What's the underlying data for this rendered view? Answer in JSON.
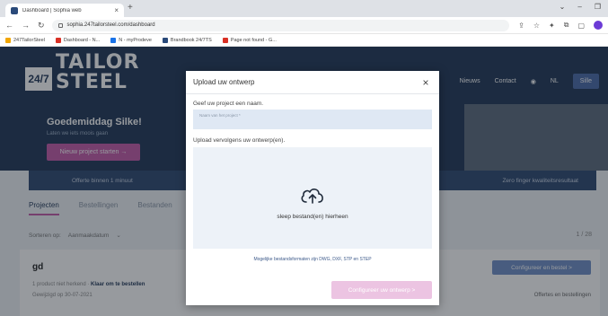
{
  "browser": {
    "tab_title": "Dashboard | Sophia web",
    "tab_close": "×",
    "new_tab": "+",
    "url": "sophia.247tailorsteel.com/dashboard",
    "bookmarks": [
      {
        "label": "247TailorSteel",
        "color": "#f2a600"
      },
      {
        "label": "Dashboard - N...",
        "color": "#d93025"
      },
      {
        "label": "N - myProdeve",
        "color": "#1a73e8"
      },
      {
        "label": "Brandbook 24/7TS",
        "color": "#2a4a7a"
      },
      {
        "label": "Page not found - G...",
        "color": "#d93025"
      }
    ]
  },
  "header": {
    "logo_badge": "24/7",
    "logo_word1": "TAILOR",
    "logo_word2": "STEEL",
    "nav": [
      "Nieuws",
      "Contact"
    ],
    "language": "NL",
    "cta": "Sille"
  },
  "hero": {
    "greeting": "Goedemiddag Silke!",
    "subtitle": "Laten we iets moois gaan",
    "new_project_button": "Nieuw project starten →"
  },
  "infobar": {
    "left": "Offerte binnen 1 minuut",
    "right": "Zero finger kwaliteitsresultaat"
  },
  "tabs": [
    "Projecten",
    "Bestellingen",
    "Bestanden"
  ],
  "sort": {
    "label": "Sorteren op:",
    "value": "Aanmaakdatum"
  },
  "pager": "1 / 28",
  "project": {
    "name": "gd",
    "status_prefix": "1 product niet herkend · ",
    "status_action": "Klaar om te bestellen",
    "date": "Gewijzigd op 30-07-2021",
    "configure_button": "Configureer en bestel >",
    "link": "Offertes en bestellingen"
  },
  "modal": {
    "title": "Upload uw ontwerp",
    "close": "×",
    "name_label": "Geef uw project een naam.",
    "name_placeholder": "Naam van het project *",
    "upload_label": "Upload vervolgens uw ontwerp(en).",
    "drop_text": "sleep bestand(en) hierheen",
    "formats_note": "Mogelijke bestandsformaten zijn DWG, DXF, STP en STEP",
    "configure_button": "Configureer uw ontwerp >"
  }
}
